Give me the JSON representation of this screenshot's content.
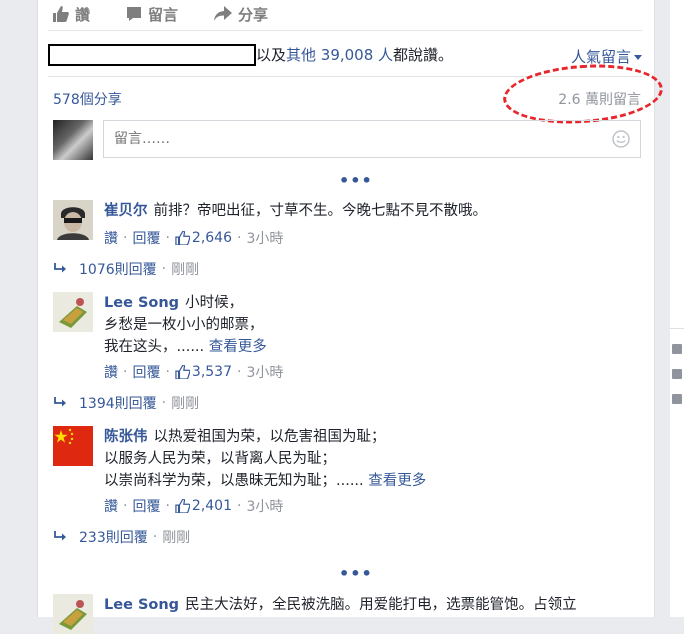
{
  "actions": {
    "like": "讚",
    "comment": "留言",
    "share": "分享"
  },
  "likes": {
    "text_prefix": "以及",
    "others": "其他 39,008 人",
    "text_suffix": "都說讚。"
  },
  "popular_comments": "人氣留言",
  "shares": "578個分享",
  "comment_count": "2.6 萬則留言",
  "comment_input": {
    "placeholder": "留言……"
  },
  "more_dots": "•••",
  "comments": [
    {
      "name": "崔贝尔",
      "lines": [
        "前排？帝吧出征，寸草不生。今晚七點不見不散哦。"
      ],
      "see_more": "",
      "like": "讚",
      "reply": "回覆",
      "likes": "2,646",
      "time": "3小時",
      "replies": "1076則回覆",
      "reply_time": "剛剛"
    },
    {
      "name": "Lee Song",
      "lines": [
        "小时候，",
        "乡愁是一枚小小的邮票，",
        "我在这头，......"
      ],
      "see_more": "查看更多",
      "like": "讚",
      "reply": "回覆",
      "likes": "3,537",
      "time": "3小時",
      "replies": "1394則回覆",
      "reply_time": "剛剛"
    },
    {
      "name": "陈张伟",
      "lines": [
        "以热爱祖国为荣，以危害祖国为耻；",
        "以服务人民为荣，以背离人民为耻；",
        "以崇尚科学为荣，以愚昧无知为耻；......"
      ],
      "see_more": "查看更多",
      "like": "讚",
      "reply": "回覆",
      "likes": "2,401",
      "time": "3小時",
      "replies": "233則回覆",
      "reply_time": "剛剛"
    },
    {
      "name": "Lee Song",
      "lines": [
        "民主大法好，全民被洗脑。用爱能打电，选票能管饱。占领立"
      ]
    }
  ],
  "colors": {
    "link": "#365899",
    "meta": "#90949c",
    "circle": "#e8262c"
  }
}
